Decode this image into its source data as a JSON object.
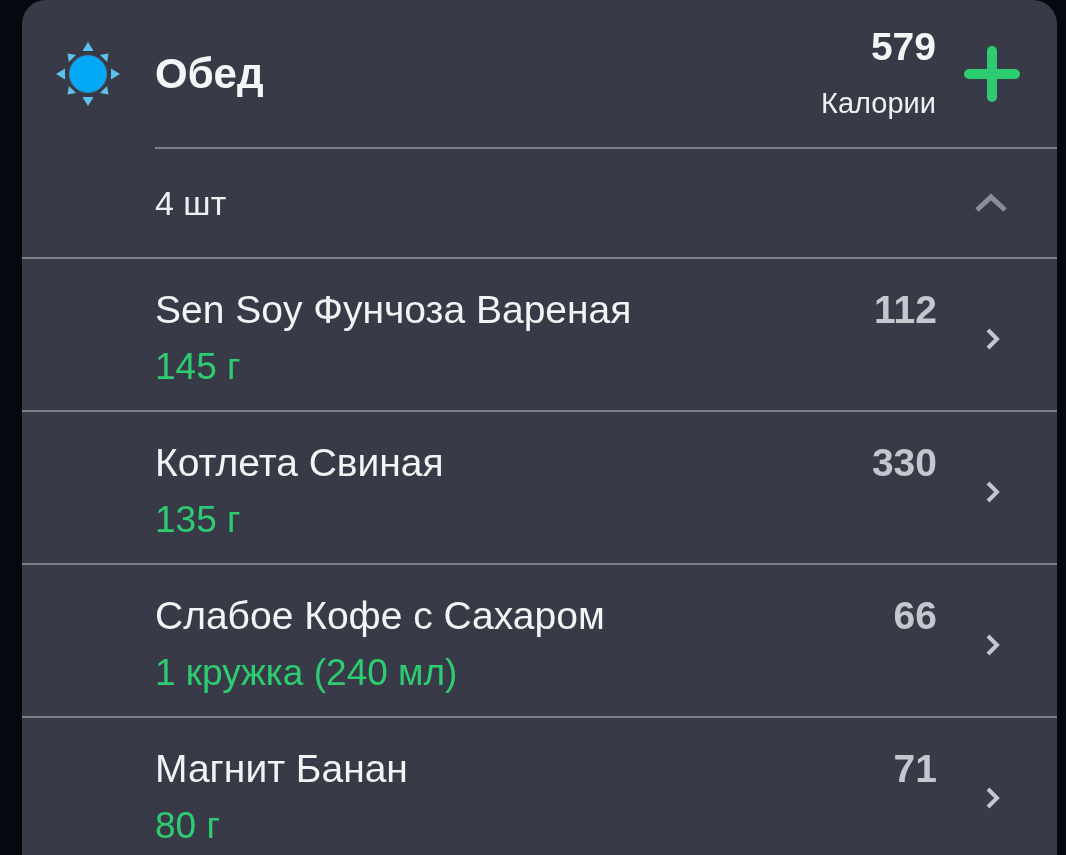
{
  "meal": {
    "title": "Обед",
    "calories": "579",
    "calories_label": "Калории"
  },
  "summary": {
    "count": "4 шт",
    "expanded": true
  },
  "items": [
    {
      "name": "Sen Soy Фунчоза Вареная",
      "calories": "112",
      "portion": "145 г"
    },
    {
      "name": "Котлета Свиная",
      "calories": "330",
      "portion": "135 г"
    },
    {
      "name": "Слабое Кофе с Сахаром",
      "calories": "66",
      "portion": "1 кружка (240 мл)"
    },
    {
      "name": "Магнит Банан",
      "calories": "71",
      "portion": "80 г"
    }
  ]
}
